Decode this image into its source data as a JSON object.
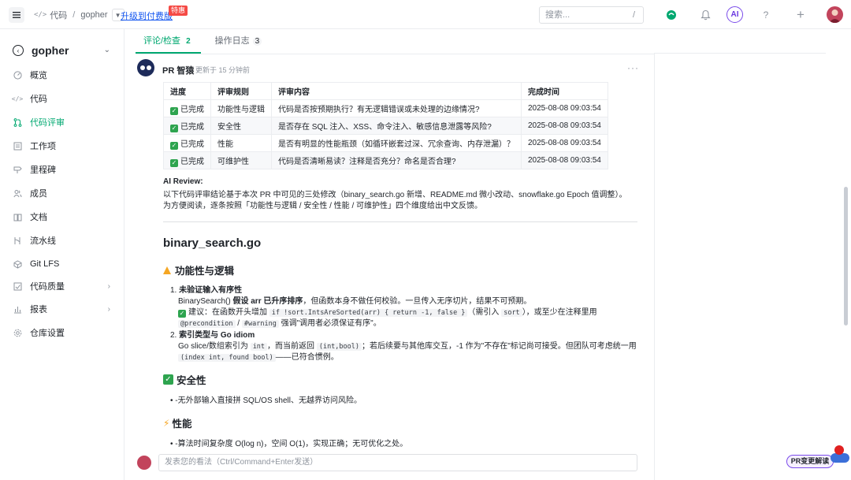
{
  "topbar": {
    "breadcrumb": [
      "代码",
      "gopher"
    ],
    "upgrade_label": "升级到付费版",
    "hot_badge": "特惠",
    "search_placeholder": "搜索...",
    "search_hint": "/",
    "ai_label": "AI",
    "help_label": "?",
    "plus_label": "+"
  },
  "sidebar": {
    "repo_name": "gopher",
    "items": [
      {
        "label": "概览",
        "icon": "dashboard-icon"
      },
      {
        "label": "代码",
        "icon": "code-icon"
      },
      {
        "label": "代码评审",
        "icon": "merge-request-icon"
      },
      {
        "label": "工作项",
        "icon": "issue-icon"
      },
      {
        "label": "里程碑",
        "icon": "milestone-icon"
      },
      {
        "label": "成员",
        "icon": "members-icon"
      },
      {
        "label": "文档",
        "icon": "docs-icon"
      },
      {
        "label": "流水线",
        "icon": "pipeline-icon"
      },
      {
        "label": "Git LFS",
        "icon": "lfs-icon"
      },
      {
        "label": "代码质量",
        "icon": "quality-icon"
      },
      {
        "label": "报表",
        "icon": "report-icon"
      },
      {
        "label": "仓库设置",
        "icon": "settings-icon"
      }
    ],
    "active_index": 2
  },
  "tabs": [
    {
      "label": "评论/检查",
      "count": "2"
    },
    {
      "label": "操作日志",
      "count": "3"
    }
  ],
  "comment": {
    "author": "PR 智猿",
    "updated": "更新于 15 分钟前",
    "more": "···",
    "table": {
      "headers": [
        "进度",
        "评审规则",
        "评审内容",
        "完成时间"
      ],
      "rows": [
        {
          "status": "已完成",
          "rule": "功能性与逻辑",
          "content": "代码是否按预期执行？有无逻辑错误或未处理的边缘情况?",
          "time": "2025-08-08 09:03:54"
        },
        {
          "status": "已完成",
          "rule": "安全性",
          "content": "是否存在 SQL 注入、XSS、命令注入、敏感信息泄露等风险?",
          "time": "2025-08-08 09:03:54"
        },
        {
          "status": "已完成",
          "rule": "性能",
          "content": "是否有明显的性能瓶颈（如循环嵌套过深、冗余查询、内存泄漏）？",
          "time": "2025-08-08 09:03:54"
        },
        {
          "status": "已完成",
          "rule": "可维护性",
          "content": "代码是否清晰易读？注释是否充分？命名是否合理?",
          "time": "2025-08-08 09:03:54"
        }
      ]
    },
    "ai_review_title": "AI Review:",
    "ai_line1": "以下代码评审结论基于本次 PR 中可见的三处修改（binary_search.go 新增、README.md 微小改动、snowflake.go Epoch 值调整）。",
    "ai_line2": "为方便阅读，逐条按照「功能性与逻辑 / 安全性 / 性能 / 可维护性」四个维度给出中文反馈。",
    "file_title": "binary_search.go",
    "sec1_title": "功能性与逻辑",
    "item1_title": "未验证输入有序性",
    "item1_a_pre": "BinarySearch() ",
    "item1_a_bold": "假设 arr 已升序排序",
    "item1_a_post": "，但函数本身不做任何校验。一旦传入无序切片，结果不可预期。",
    "item1_b_pre": "建议：在函数开头增加 ",
    "item1_b_code": "if !sort.IntsAreSorted(arr) { return -1, false }",
    "item1_b_mid": "（需引入 ",
    "item1_b_code2": "sort",
    "item1_b_post": "），或至少在注释里用",
    "item1_c_code": "@precondition",
    "item1_c_sep": " / ",
    "item1_c_code2": "#warning",
    "item1_c_post": " 强调\"调用者必须保证有序\"。",
    "item2_title": "索引类型与 Go idiom",
    "item2_a_pre": "Go slice/数组索引为 ",
    "item2_a_code": "int",
    "item2_a_mid": "，而当前返回 ",
    "item2_a_code2": "(int,bool)",
    "item2_a_post": "；若后续要与其他库交互，-1 作为\"不存在\"标记尚可接受。但团队可考虑统一用",
    "item2_b_code": "(index int, found bool)",
    "item2_b_post": "——已符合惯例。",
    "sec2_title": "安全性",
    "sec2_item": "-无外部输入直接拼 SQL/OS shell、无越界访问风险。",
    "sec3_title": "性能",
    "sec3_item": "-算法时间复杂度 O(log n)，空间 O(1)，实现正确；无可优化之处。"
  },
  "comment_input_placeholder": "发表您的看法（Ctrl/Command+Enter发送）",
  "pr_chip_label": "PR变更解读",
  "colors": {
    "accent": "#00a870",
    "link": "#1456f0",
    "ai": "#7a4bea"
  }
}
